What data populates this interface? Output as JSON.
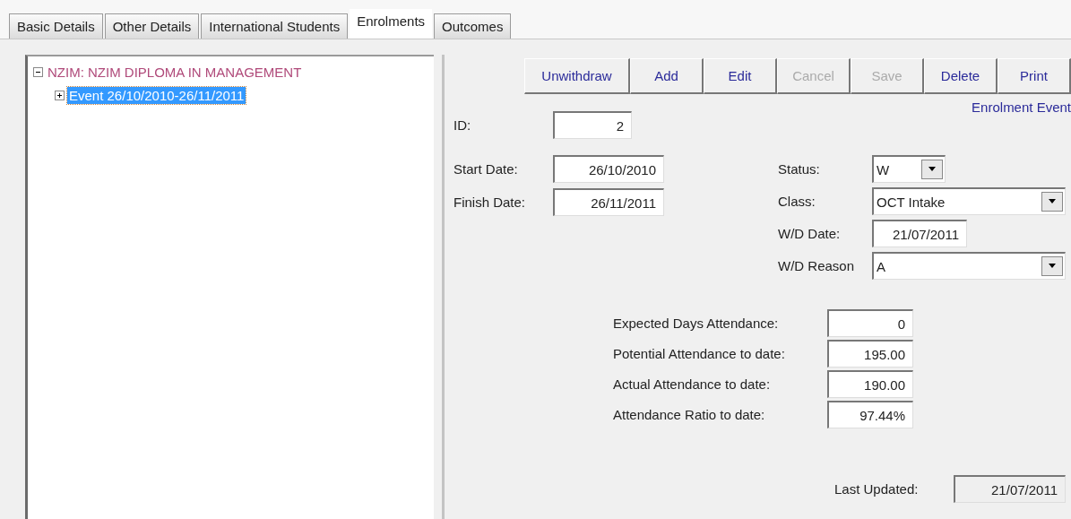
{
  "tabs": [
    {
      "label": "Basic Details",
      "selected": false
    },
    {
      "label": "Other Details",
      "selected": false
    },
    {
      "label": "International Students",
      "selected": false
    },
    {
      "label": "Enrolments",
      "selected": true
    },
    {
      "label": "Outcomes",
      "selected": false
    }
  ],
  "tree": [
    {
      "label": "NZIM: NZIM DIPLOMA IN MANAGEMENT",
      "expanded": true,
      "selected": false,
      "children": [
        {
          "label": "Event 26/10/2010-26/11/2011",
          "expanded": false,
          "selected": true
        }
      ]
    }
  ],
  "toolbar": [
    {
      "label": "Unwithdraw",
      "disabled": false
    },
    {
      "label": "Add",
      "disabled": false
    },
    {
      "label": "Edit",
      "disabled": false
    },
    {
      "label": "Cancel",
      "disabled": true
    },
    {
      "label": "Save",
      "disabled": true
    },
    {
      "label": "Delete",
      "disabled": false
    },
    {
      "label": "Print",
      "disabled": false
    }
  ],
  "section_title": "Enrolment Event",
  "id": {
    "label": "ID:",
    "value": "2"
  },
  "left_fields": [
    {
      "label": "Start Date:",
      "value": "26/10/2010"
    },
    {
      "label": "Finish Date:",
      "value": "26/11/2011"
    }
  ],
  "right_fields": [
    {
      "kind": "combo",
      "label": "Status:",
      "value": "W"
    },
    {
      "kind": "combo",
      "label": "Class:",
      "value": "OCT Intake"
    },
    {
      "kind": "text",
      "label": "W/D Date:",
      "value": "21/07/2011"
    },
    {
      "kind": "combo",
      "label": "W/D Reason",
      "value": "A"
    }
  ],
  "attendance": [
    {
      "label": "Expected Days Attendance:",
      "value": "0"
    },
    {
      "label": "Potential Attendance to date:",
      "value": "195.00"
    },
    {
      "label": "Actual Attendance to date:",
      "value": "190.00"
    },
    {
      "label": "Attendance Ratio to date:",
      "value": "97.44%"
    }
  ],
  "last_updated": {
    "label": "Last Updated:",
    "value": "21/07/2011",
    "disabled": true
  }
}
